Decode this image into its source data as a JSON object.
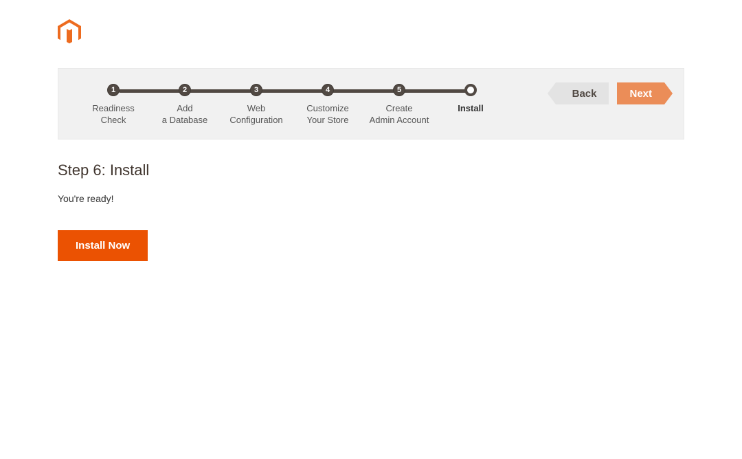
{
  "steps": [
    {
      "num": "1",
      "label": "Readiness\nCheck"
    },
    {
      "num": "2",
      "label": "Add\na Database"
    },
    {
      "num": "3",
      "label": "Web\nConfiguration"
    },
    {
      "num": "4",
      "label": "Customize\nYour Store"
    },
    {
      "num": "5",
      "label": "Create\nAdmin Account"
    },
    {
      "num": "",
      "label": "Install"
    }
  ],
  "nav": {
    "back": "Back",
    "next": "Next"
  },
  "content": {
    "title": "Step 6: Install",
    "ready": "You're ready!",
    "install_button": "Install Now"
  },
  "colors": {
    "accent": "#eb5202",
    "accent_light": "#eb8d58",
    "step_dark": "#514943"
  }
}
